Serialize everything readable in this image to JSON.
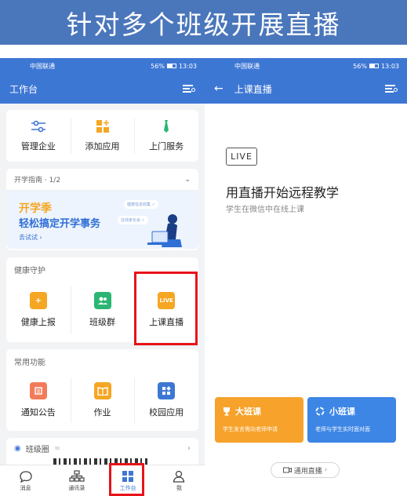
{
  "banner": {
    "title": "针对多个班级开展直播"
  },
  "status": {
    "carrier": "中国联通",
    "battery": "56%",
    "time": "13:03"
  },
  "left": {
    "appbar_title": "工作台",
    "top_actions": [
      {
        "label": "管理企业",
        "icon": "sliders-icon",
        "color": "#3d77d4"
      },
      {
        "label": "添加应用",
        "icon": "app-grid-icon",
        "color": "#f5a623"
      },
      {
        "label": "上门服务",
        "icon": "tie-icon",
        "color": "#2bb673"
      }
    ],
    "guide": {
      "header": "开学指南 · 1/2",
      "title1": "开学季",
      "title2": "轻松搞定开学事务",
      "try_link": "去试试 ›",
      "tag1": "健康信息收集 ✓",
      "tag2": "在线家长会 ✓"
    },
    "health": {
      "title": "健康守护",
      "items": [
        {
          "label": "健康上报",
          "icon": "health-report-icon",
          "color": "#f5a623"
        },
        {
          "label": "班级群",
          "icon": "class-group-icon",
          "color": "#2bb673"
        },
        {
          "label": "上课直播",
          "icon": "live-icon",
          "color": "#f5a623",
          "icon_text": "LIVE"
        }
      ]
    },
    "common": {
      "title": "常用功能",
      "items": [
        {
          "label": "通知公告",
          "icon": "notice-icon",
          "color": "#f27b5a"
        },
        {
          "label": "作业",
          "icon": "homework-icon",
          "color": "#f5a623"
        },
        {
          "label": "校园应用",
          "icon": "campus-apps-icon",
          "color": "#3d77d4"
        }
      ]
    },
    "class_circle": {
      "label": "班级圈"
    },
    "tabs": [
      {
        "label": "消息",
        "icon": "message-icon"
      },
      {
        "label": "通讯录",
        "icon": "contacts-icon"
      },
      {
        "label": "工作台",
        "icon": "workbench-icon",
        "active": true
      },
      {
        "label": "我",
        "icon": "profile-icon"
      }
    ]
  },
  "right": {
    "appbar_title": "上课直播",
    "live_badge": "LIVE",
    "title": "用直播开始远程教学",
    "subtitle": "学生在微信中在线上课",
    "big_class": {
      "title": "大班课",
      "desc": "学生发言需向老师申请"
    },
    "small_class": {
      "title": "小班课",
      "desc": "老师与学生实时面对面"
    },
    "general_live": "通用直播"
  },
  "colors": {
    "brand": "#3d77d4",
    "highlight": "#e8131a",
    "banner": "#4a76bb"
  }
}
